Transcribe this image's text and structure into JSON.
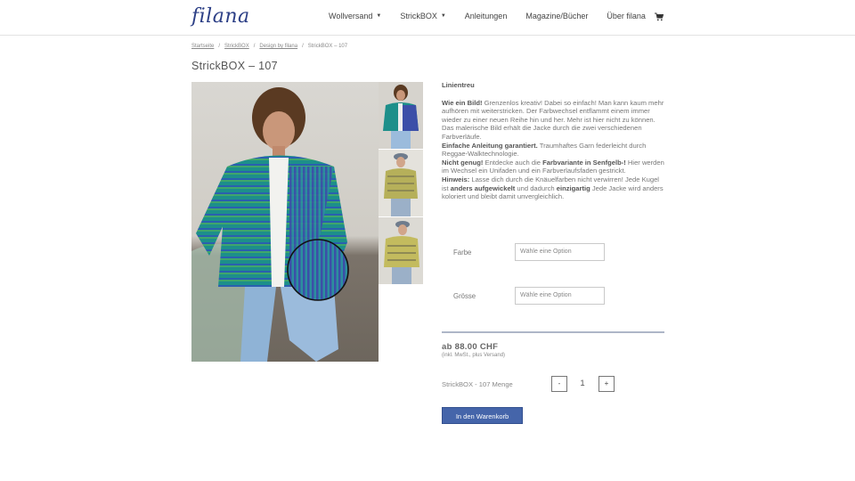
{
  "brand": {
    "logo_text": "filana",
    "color": "#2c3f86"
  },
  "nav": {
    "items": [
      {
        "label": "Wollversand",
        "has_dropdown": true
      },
      {
        "label": "StrickBOX",
        "has_dropdown": true
      },
      {
        "label": "Anleitungen",
        "has_dropdown": false
      },
      {
        "label": "Magazine/Bücher",
        "has_dropdown": false
      },
      {
        "label": "Über filana",
        "has_dropdown": false
      }
    ],
    "caret": "▼",
    "cart_icon": "shopping-cart-icon"
  },
  "breadcrumb": {
    "separator": "/",
    "items": [
      "Startseite",
      "StrickBOX",
      "Design by filana"
    ],
    "current": "StrickBOX – 107"
  },
  "product": {
    "title": "StrickBOX – 107",
    "description": {
      "heading": "Linientreu",
      "p1_bold": "Wie ein Bild!",
      "p1_text": " Grenzenlos kreativ! Dabei so einfach! Man kann kaum mehr aufhören mit weiterstricken. Der Farbwechsel entflammt einem immer wieder zu einer neuen Reihe hin und her. Mehr ist hier nicht zu können. Das malerische Bild erhält die Jacke durch die zwei verschiedenen Farbverläufe.",
      "p2_bold": "Einfache Anleitung garantiert.",
      "p2_text": " Traumhaftes Garn federleicht durch Reggae-Walktechnologie.",
      "p3_bold": "Nicht genug!",
      "p3_text_a": " Entdecke auch die ",
      "p3_bold2": "Farbvariante in Senfgelb-!",
      "p3_text_b": " Hier werden im Wechsel ein Unifaden und ein Farbverlaufsfaden gestrickt.",
      "p4_bold": "Hinweis:",
      "p4_text_a": " Lasse dich durch die Knäuelfarben nicht verwirren! Jede Kugel ist ",
      "p4_bold2": "anders aufgewickelt",
      "p4_text_b": " und dadurch ",
      "p4_bold3": "einzigartig",
      "p4_text_c": " Jede Jacke wird anders koloriert und bleibt damit unvergleichlich."
    },
    "variations": {
      "farbe_label": "Farbe",
      "farbe_placeholder": "Wähle eine Option",
      "groesse_label": "Grösse",
      "groesse_placeholder": "Wähle eine Option"
    },
    "price": "ab 88.00 CHF",
    "price_note": "(inkl. MwSt., plus Versand)",
    "quantity_label": "StrickBOX - 107 Menge",
    "quantity": "1",
    "minus": "-",
    "plus": "+",
    "add_to_cart": "In den Warenkorb"
  },
  "colors": {
    "accent_button": "#4565aa",
    "divider": "#aeb6c8"
  }
}
